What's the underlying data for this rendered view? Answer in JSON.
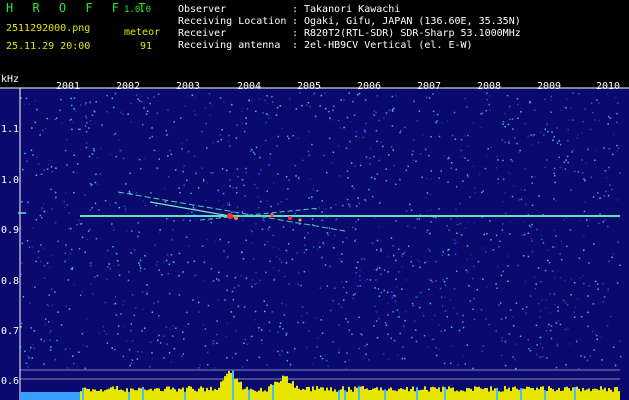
{
  "header": {
    "app_title": "H R O F F T",
    "app_version": "1.0.0",
    "filename": "2511292000.png",
    "datetime": "25.11.29 20:00",
    "meteor_label": "meteor",
    "meteor_count": "91"
  },
  "station_info": [
    {
      "label": "Observer",
      "value": "Takanori Kawachi"
    },
    {
      "label": "Receiving Location",
      "value": "Ogaki, Gifu, JAPAN (136.60E, 35.35N)"
    },
    {
      "label": "Receiver",
      "value": "R820T2(RTL-SDR) SDR-Sharp 53.1000MHz"
    },
    {
      "label": "Receiving antenna",
      "value": "2el-HB9CV Vertical (el. E-W)"
    }
  ],
  "spectrogram": {
    "unit_label": "kHz",
    "y_ticks": [
      "1.1",
      "1.0",
      "0.9",
      "0.8",
      "0.7",
      "0.6"
    ],
    "x_ticks": [
      "2001",
      "2002",
      "2003",
      "2004",
      "2005",
      "2006",
      "2007",
      "2008",
      "2009",
      "2010"
    ],
    "carrier_khz": 0.925,
    "colors": {
      "background": "#0a0a6e",
      "carrier": "#5fe0c0",
      "echo": "#ff3030",
      "level": "#e6e600",
      "axis": "#ffffff"
    }
  },
  "colon": ":"
}
